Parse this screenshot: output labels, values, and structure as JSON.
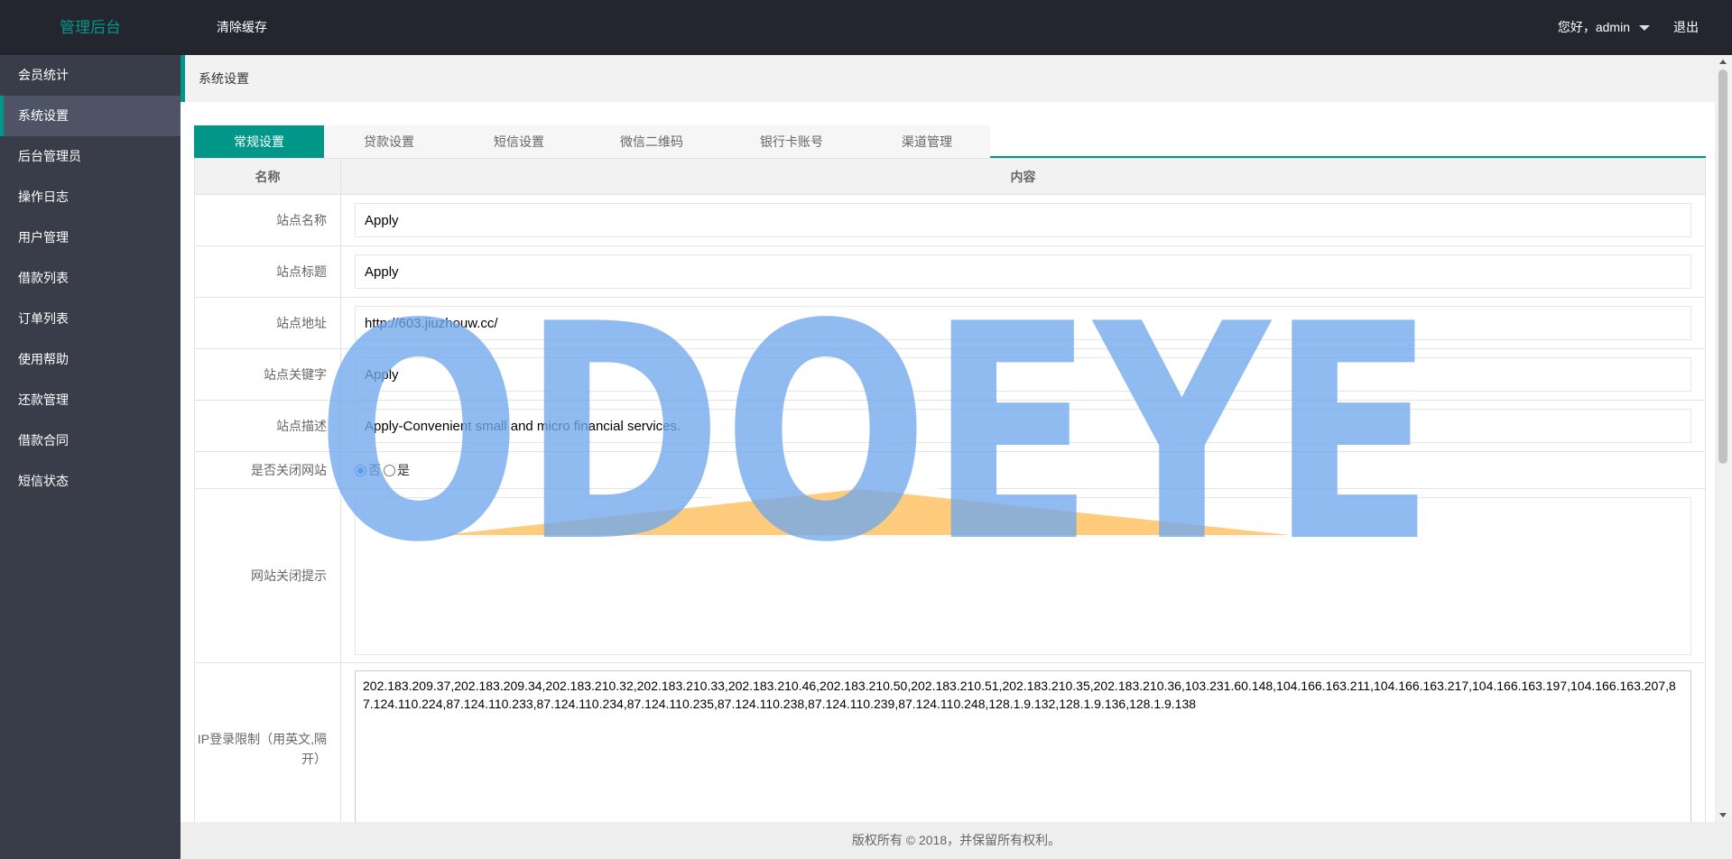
{
  "header": {
    "logo": "管理后台",
    "clear_cache": "清除缓存",
    "greeting": "您好，admin",
    "logout": "退出"
  },
  "sidebar": {
    "items": [
      {
        "label": "会员统计"
      },
      {
        "label": "系统设置"
      },
      {
        "label": "后台管理员"
      },
      {
        "label": "操作日志"
      },
      {
        "label": "用户管理"
      },
      {
        "label": "借款列表"
      },
      {
        "label": "订单列表"
      },
      {
        "label": "使用帮助"
      },
      {
        "label": "还款管理"
      },
      {
        "label": "借款合同"
      },
      {
        "label": "短信状态"
      }
    ],
    "active_index": 1
  },
  "breadcrumb": "系统设置",
  "tabs": [
    {
      "label": "常规设置"
    },
    {
      "label": "贷款设置"
    },
    {
      "label": "短信设置"
    },
    {
      "label": "微信二维码"
    },
    {
      "label": "银行卡账号"
    },
    {
      "label": "渠道管理"
    }
  ],
  "table": {
    "col_name": "名称",
    "col_content": "内容",
    "site_name": {
      "label": "站点名称",
      "value": "Apply"
    },
    "site_title": {
      "label": "站点标题",
      "value": "Apply"
    },
    "site_url": {
      "label": "站点地址",
      "value": "http://603.jiuzhouw.cc/"
    },
    "site_keywords": {
      "label": "站点关键字",
      "value": "Apply"
    },
    "site_desc": {
      "label": "站点描述",
      "value": "Apply-Convenient small and micro financial services."
    },
    "close_site": {
      "label": "是否关闭网站",
      "option_no": "否",
      "option_yes": "是",
      "selected": "否"
    },
    "close_notice": {
      "label": "网站关闭提示",
      "value": ""
    },
    "ip_limit": {
      "label": "IP登录限制（用英文,隔开）",
      "value": "202.183.209.37,202.183.209.34,202.183.210.32,202.183.210.33,202.183.210.46,202.183.210.50,202.183.210.51,202.183.210.35,202.183.210.36,103.231.60.148,104.166.163.211,104.166.163.217,104.166.163.197,104.166.163.207,87.124.110.224,87.124.110.233,87.124.110.234,87.124.110.235,87.124.110.238,87.124.110.239,87.124.110.248,128.1.9.132,128.1.9.136,128.1.9.138"
    }
  },
  "footer": "版权所有 © 2018，并保留所有权利。",
  "watermark": {
    "text": "ODOEYE",
    "color": "#6fa8ec",
    "accent": "#ffc266"
  },
  "colors": {
    "accent": "#009688",
    "header_bg": "#23262e",
    "sidebar_bg": "#393d49"
  }
}
